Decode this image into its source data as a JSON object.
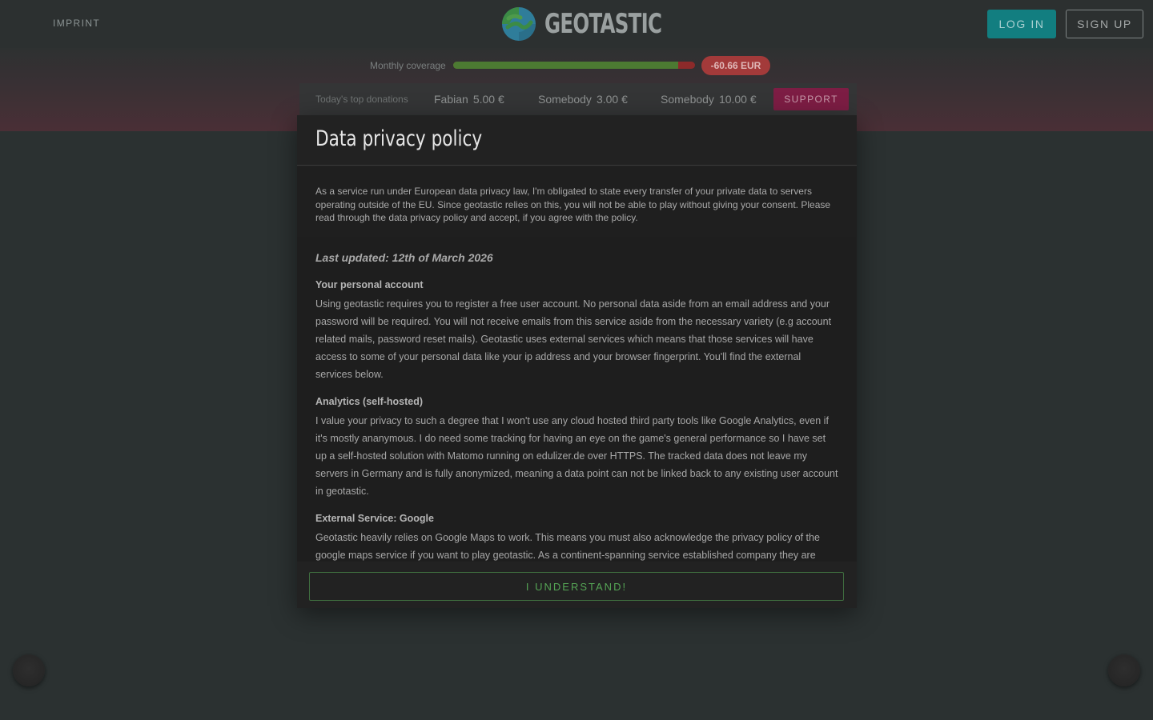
{
  "header": {
    "imprint_label": "IMPRINT",
    "logo_text": "GEOTASTIC",
    "login_label": "LOG IN",
    "signup_label": "SIGN UP"
  },
  "coverage": {
    "label": "Monthly coverage",
    "fill_fraction": 0.93,
    "balance": "-60.66 EUR"
  },
  "donations": {
    "label": "Today's top donations",
    "items": [
      {
        "name": "Fabian",
        "amount": "5.00 €"
      },
      {
        "name": "Somebody",
        "amount": "3.00 €"
      },
      {
        "name": "Somebody",
        "amount": "10.00 €"
      }
    ],
    "support_label": "SUPPORT"
  },
  "modal": {
    "title": "Data privacy policy",
    "intro": "As a service run under European data privacy law, I'm obligated to state every transfer of your private data to servers operating outside of the EU. Since geotastic relies on this, you will not be able to play without giving your consent. Please read through the data privacy policy and accept, if you agree with the policy.",
    "last_updated": "Last updated: 12th of March 2026",
    "sections": [
      {
        "title": "Your personal account",
        "text": "Using geotastic requires you to register a free user account. No personal data aside from an email address and your password will be required. You will not receive emails from this service aside from the necessary variety (e.g account related mails, password reset mails). Geotastic uses external services which means that those services will have access to some of your personal data like your ip address and your browser fingerprint. You'll find the external services below."
      },
      {
        "title": "Analytics (self-hosted)",
        "text": "I value your privacy to such a degree that I won't use any cloud hosted third party tools like Google Analytics, even if it's mostly ananymous. I do need some tracking for having an eye on the game's general performance so I have set up a self-hosted solution with Matomo running on edulizer.de over HTTPS. The tracked data does not leave my servers in Germany and is fully anonymized, meaning a data point can not be linked back to any existing user account in geotastic."
      },
      {
        "title": "External Service: Google",
        "text": "Geotastic heavily relies on Google Maps to work. This means you must also acknowledge the privacy policy of the google maps service if you want to play geotastic. As a continent-spanning service established company they are"
      }
    ],
    "understand_label": "I UNDERSTAND!"
  },
  "colors": {
    "logo_green": "#3c8b45",
    "logo_blue": "#2f7d9a",
    "login_bg": "#127e80",
    "coverage_fill": "#4c7a32",
    "coverage_deficit": "#8c2a2a",
    "support_bg": "#7d1d44",
    "understand_green": "#55a455"
  }
}
